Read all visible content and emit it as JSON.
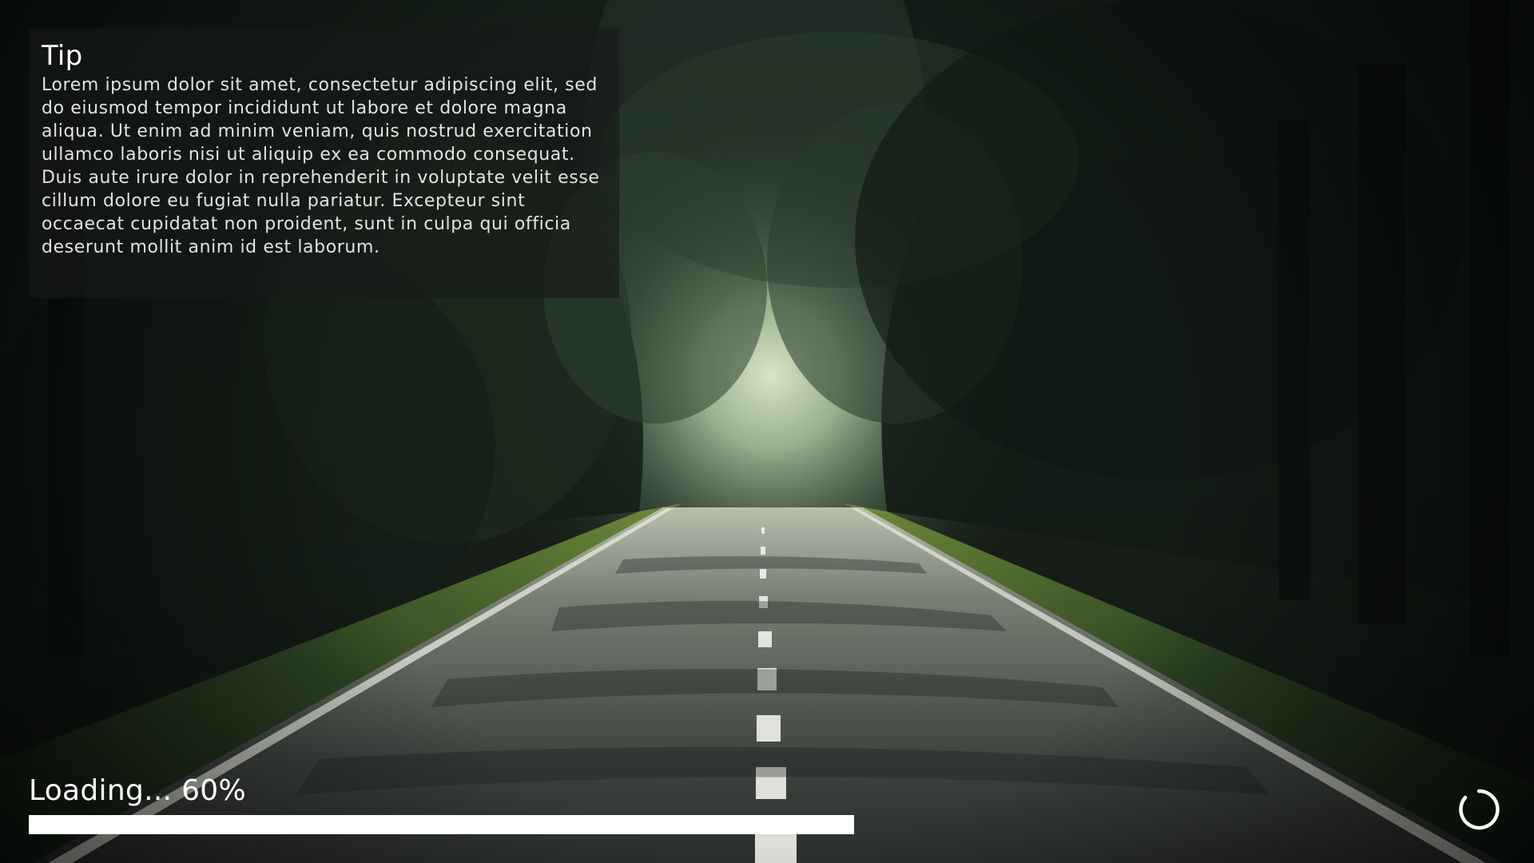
{
  "scene": {
    "description_icon": "forest-road-background"
  },
  "tip": {
    "title": "Tip",
    "body": "Lorem ipsum dolor sit amet, consectetur adipiscing elit, sed do eiusmod tempor incididunt ut labore et dolore magna aliqua. Ut enim ad minim veniam, quis nostrud exercitation ullamco laboris nisi ut aliquip ex ea commodo consequat. Duis aute irure dolor in reprehenderit in voluptate velit esse cillum dolore eu fugiat nulla pariatur. Excepteur sint occaecat cupidatat non proident, sunt in culpa qui officia deserunt mollit anim id est laborum."
  },
  "loading": {
    "label": "Loading... 60%",
    "progress_fraction": 0.6
  },
  "icons": {
    "spinner": "loading-spinner-icon"
  },
  "colors": {
    "progress_fill": "#ffffff",
    "text": "#ffffff"
  }
}
